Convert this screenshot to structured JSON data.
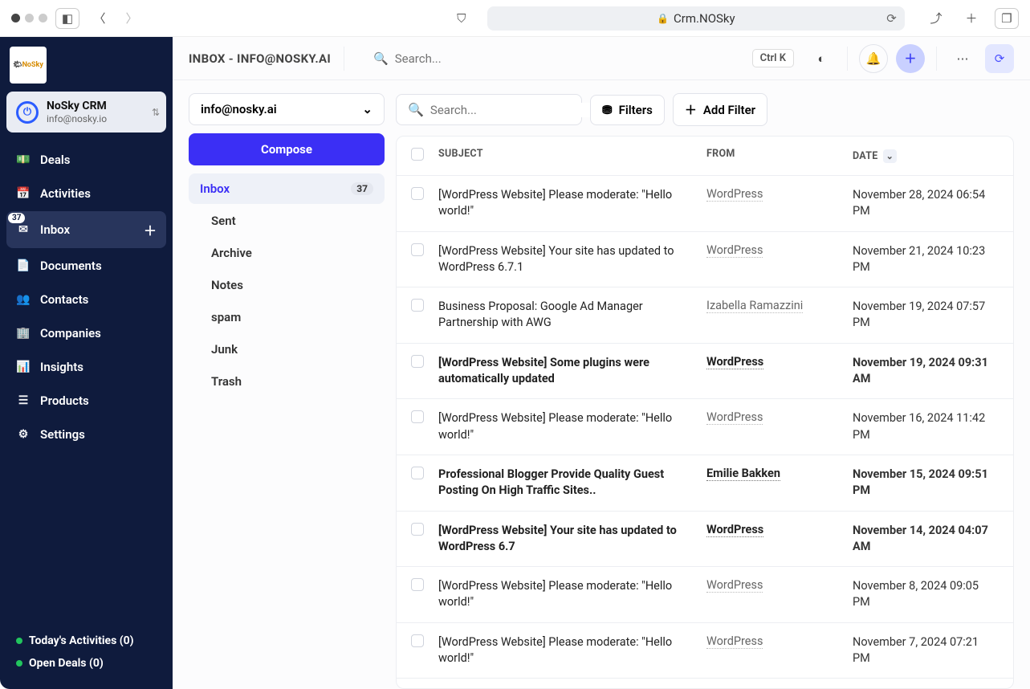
{
  "browser": {
    "url": "Crm.NOSky"
  },
  "sidebar": {
    "org_name": "NoSky CRM",
    "org_email": "info@nosky.io",
    "items": [
      {
        "label": "Deals",
        "icon": "💵"
      },
      {
        "label": "Activities",
        "icon": "📅"
      },
      {
        "label": "Inbox",
        "icon": "✉",
        "badge": "37",
        "active": true
      },
      {
        "label": "Documents",
        "icon": "📄"
      },
      {
        "label": "Contacts",
        "icon": "👥"
      },
      {
        "label": "Companies",
        "icon": "🏢"
      },
      {
        "label": "Insights",
        "icon": "📊"
      },
      {
        "label": "Products",
        "icon": "☰"
      },
      {
        "label": "Settings",
        "icon": "⚙"
      }
    ],
    "bottom": [
      {
        "label": "Today's Activities (0)"
      },
      {
        "label": "Open Deals (0)"
      }
    ]
  },
  "topbar": {
    "title": "INBOX - INFO@NOSKY.AI",
    "search_placeholder": "Search...",
    "kbd": "Ctrl K"
  },
  "compose_label": "Compose",
  "account_selected": "info@nosky.ai",
  "local_search_placeholder": "Search...",
  "filters_label": "Filters",
  "add_filter_label": "Add Filter",
  "folders": [
    {
      "label": "Inbox",
      "count": "37",
      "active": true
    },
    {
      "label": "Sent"
    },
    {
      "label": "Archive"
    },
    {
      "label": "Notes"
    },
    {
      "label": "spam"
    },
    {
      "label": "Junk"
    },
    {
      "label": "Trash"
    }
  ],
  "columns": {
    "subject": "SUBJECT",
    "from": "FROM",
    "date": "DATE"
  },
  "emails": [
    {
      "subject": "[WordPress Website] Please moderate: \"Hello world!\"",
      "from": "WordPress",
      "date": "November 28, 2024 06:54 PM",
      "unread": false
    },
    {
      "subject": "[WordPress Website] Your site has updated to WordPress 6.7.1",
      "from": "WordPress",
      "date": "November 21, 2024 10:23 PM",
      "unread": false
    },
    {
      "subject": "Business Proposal: Google Ad Manager Partnership with AWG",
      "from": "Izabella Ramazzini",
      "date": "November 19, 2024 07:57 PM",
      "unread": false
    },
    {
      "subject": "[WordPress Website] Some plugins were automatically updated",
      "from": "WordPress",
      "date": "November 19, 2024 09:31 AM",
      "unread": true
    },
    {
      "subject": "[WordPress Website] Please moderate: \"Hello world!\"",
      "from": "WordPress",
      "date": "November 16, 2024 11:42 PM",
      "unread": false
    },
    {
      "subject": "Professional Blogger Provide Quality Guest Posting On High Traffic Sites..",
      "from": "Emilie Bakken",
      "date": "November 15, 2024 09:51 PM",
      "unread": true
    },
    {
      "subject": "[WordPress Website] Your site has updated to WordPress 6.7",
      "from": "WordPress",
      "date": "November 14, 2024 04:07 AM",
      "unread": true
    },
    {
      "subject": "[WordPress Website] Please moderate: \"Hello world!\"",
      "from": "WordPress",
      "date": "November 8, 2024 09:05 PM",
      "unread": false
    },
    {
      "subject": "[WordPress Website] Please moderate: \"Hello world!\"",
      "from": "WordPress",
      "date": "November 7, 2024 07:21 PM",
      "unread": false
    }
  ]
}
